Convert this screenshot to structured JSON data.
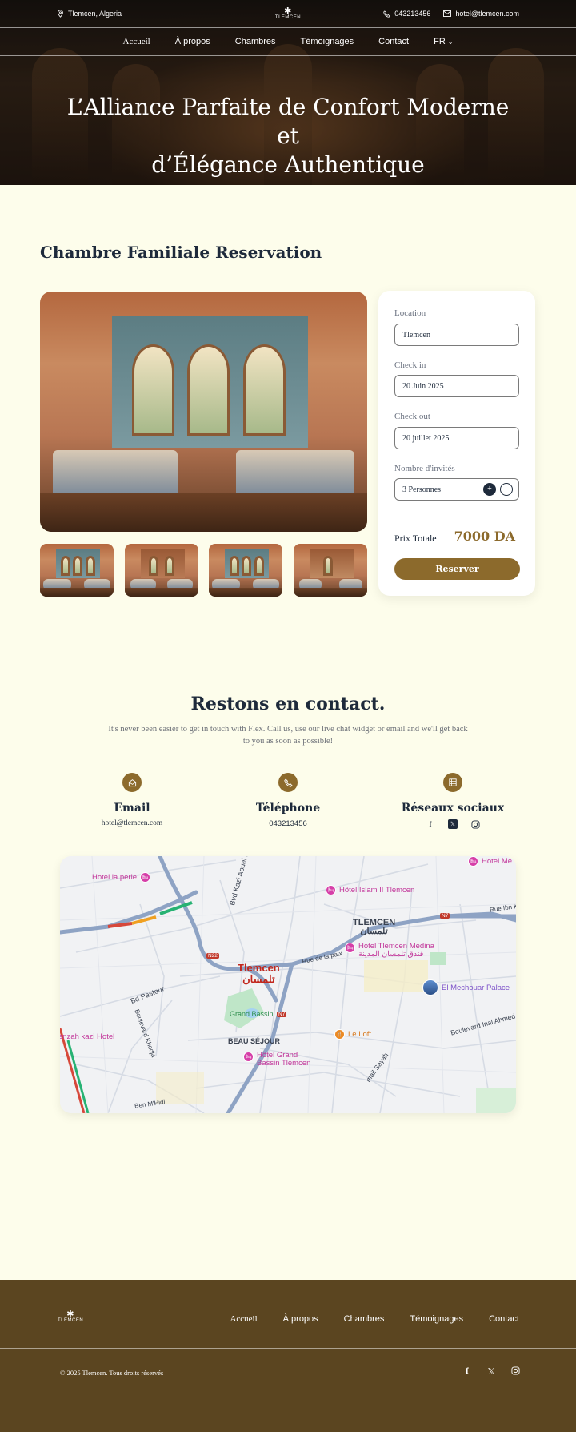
{
  "topbar": {
    "location": "Tlemcen, Algeria",
    "phone": "043213456",
    "email": "hotel@tlemcen.com",
    "logo_text": "TLEMCEN"
  },
  "nav": {
    "items": [
      "Accueil",
      "À propos",
      "Chambres",
      "Témoignages",
      "Contact"
    ],
    "language": "FR"
  },
  "hero": {
    "title_line1": "L’Alliance Parfaite de Confort Moderne et",
    "title_line2": "d’Élégance Authentique"
  },
  "reservation": {
    "title": "Chambre Familiale Reservation",
    "location_label": "Location",
    "location_value": "Tlemcen",
    "checkin_label": "Check in",
    "checkin_value": "20 Juin 2025",
    "checkout_label": "Check out",
    "checkout_value": "20 juillet 2025",
    "guests_label": "Nombre d'invités",
    "guests_value": "3 Personnes",
    "plus": "+",
    "minus": "-",
    "total_label": "Prix Totale",
    "total_value": "7000 DA",
    "button": "Reserver"
  },
  "contact": {
    "title": "Restons en contact.",
    "subtitle": "It's never been easier to get in touch with Flex. Call us, use our live chat widget or email and we'll get back to you as soon as possible!",
    "email_title": "Email",
    "email_value": "hotel@tlemcen.com",
    "phone_title": "Téléphone",
    "phone_value": "043213456",
    "social_title": "Réseaux sociaux"
  },
  "map": {
    "city": "Tlemcen",
    "city_ar": "تلمسان",
    "district": "TLEMCEN",
    "district_ar": "تلمسان",
    "hotel1": "Hotel la perle",
    "hotel2": "Hôtel Islam II Tlemcen",
    "hotel3": "Hotel Me",
    "hotel4": "Hotel Tlemcen Medina",
    "hotel4_ar": "فندق تلمسان المدينة",
    "hotel5": "enzah kazi Hotel",
    "hotel6_l1": "Hôtel Grand",
    "hotel6_l2": "Bassin Tlemcen",
    "restaurant": "Le Loft",
    "palace": "El Mechouar Palace",
    "grand_bassin": "Grand Bassin",
    "beau_sejour": "BEAU SÉJOUR",
    "road_bd_pasteur": "Bd Pasteur",
    "road_kazi": "Bvd Kazi Aouel Med",
    "road_paix": "Rue de la paix",
    "road_khodja": "Boulevard Khodja",
    "road_inal": "Boulevard Inal Ahmed",
    "road_ibn": "Rue Ibn Kh",
    "road_sayah": "mail Sayah",
    "road_mhidi": "Ben M'Hidi",
    "shield_n22": "N22",
    "shield_n7": "N7",
    "shield_n7b": "N7"
  },
  "footer": {
    "logo_text": "TLEMCEN",
    "nav": [
      "Accueil",
      "À propos",
      "Chambres",
      "Témoignages",
      "Contact"
    ],
    "copyright": "© 2025 Tlemcen. Tous droits réservés"
  },
  "colors": {
    "accent": "#8c6a2c",
    "navy": "#1e2a3b",
    "background": "#fdfdeb",
    "footer": "#5b4520"
  }
}
